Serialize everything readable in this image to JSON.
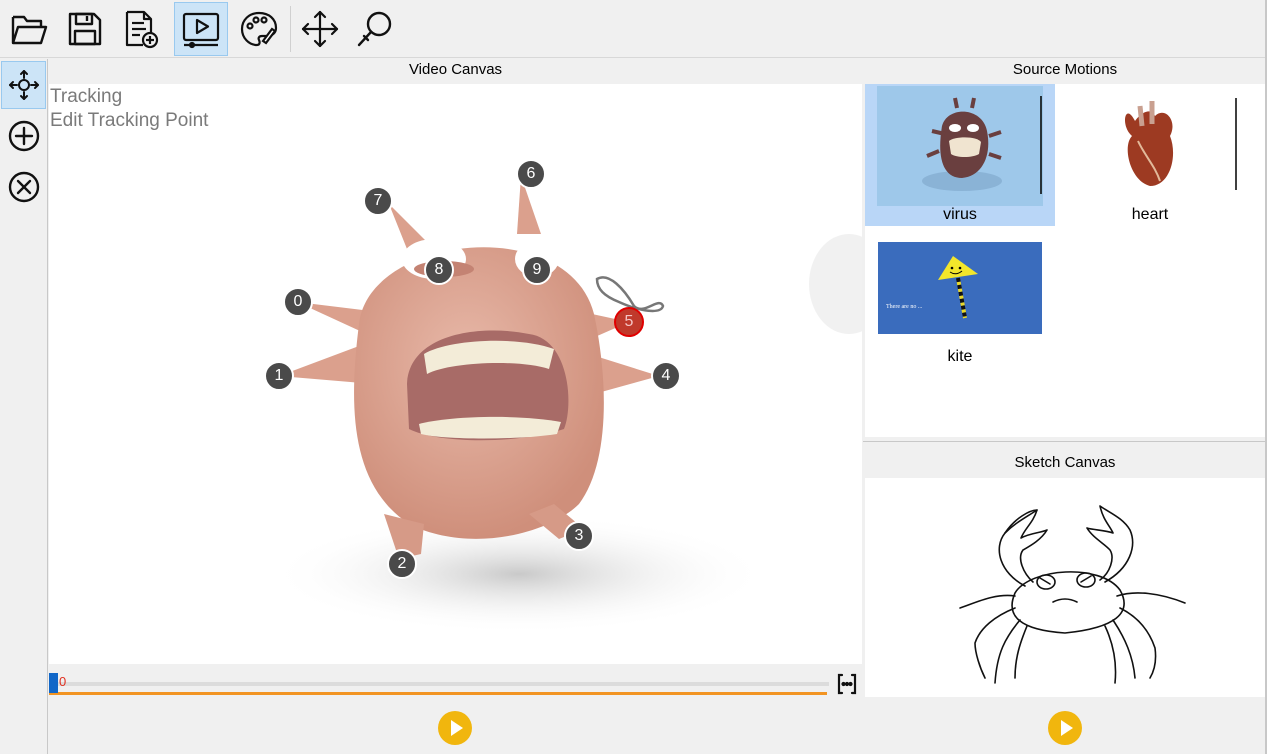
{
  "toolbar": {
    "items": [
      {
        "icon": "open-folder-icon"
      },
      {
        "icon": "save-icon"
      },
      {
        "icon": "new-document-icon"
      },
      {
        "icon": "video-mode-icon",
        "active": true
      },
      {
        "icon": "palette-icon"
      },
      {
        "icon": "move-arrows-icon"
      },
      {
        "icon": "magnifier-icon"
      }
    ]
  },
  "left_tools": [
    {
      "icon": "move-point-icon",
      "active": true
    },
    {
      "icon": "add-point-icon"
    },
    {
      "icon": "remove-point-icon"
    }
  ],
  "video": {
    "title": "Video Canvas",
    "mode_label": "Tracking",
    "sub_label": "Edit Tracking Point",
    "tracking_points": [
      {
        "label": "0"
      },
      {
        "label": "1"
      },
      {
        "label": "2"
      },
      {
        "label": "3"
      },
      {
        "label": "4"
      },
      {
        "label": "5",
        "selected": true
      },
      {
        "label": "6"
      },
      {
        "label": "7"
      },
      {
        "label": "8"
      },
      {
        "label": "9"
      }
    ],
    "timeline": {
      "current_frame": "0",
      "position_fraction": 0
    }
  },
  "source_motions": {
    "title": "Source Motions",
    "items": [
      {
        "label": "virus",
        "selected": true
      },
      {
        "label": "heart"
      },
      {
        "label": "kite",
        "caption": "There are no ... "
      }
    ]
  },
  "sketch": {
    "title": "Sketch Canvas"
  },
  "colors": {
    "accent_selected": "#cce4f7",
    "play_button": "#f1b60e",
    "timeline_progress": "#f29422",
    "timeline_handle": "#1167c8",
    "tracking_point": "#4a4a4a",
    "tracking_point_selected": "#c0392b"
  }
}
